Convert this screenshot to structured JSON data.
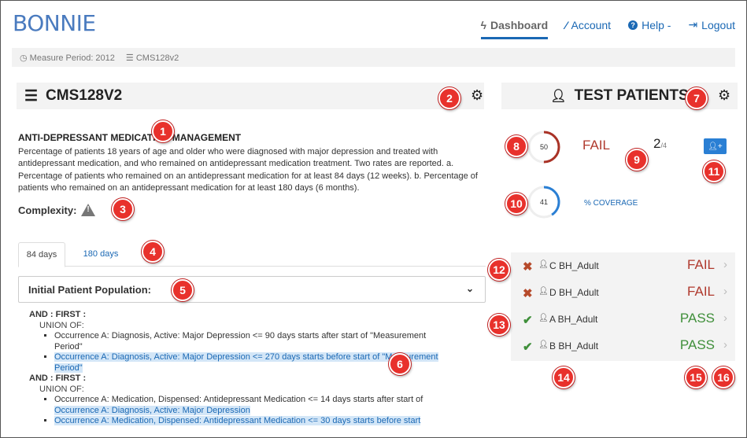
{
  "brand": "BONNIE",
  "nav": [
    {
      "icon": "lightning-icon",
      "glyph": "ϟ",
      "label": "Dashboard",
      "active": true
    },
    {
      "icon": "magic-wand-icon",
      "glyph": "⁄",
      "label": "Account"
    },
    {
      "icon": "question-circle-icon",
      "glyph": "?",
      "label": "Help -"
    },
    {
      "icon": "logout-icon",
      "glyph": "⇥",
      "label": "Logout"
    }
  ],
  "breadcrumb": {
    "period": "Measure Period: 2012",
    "measure": "CMS128v2"
  },
  "measure": {
    "header": "CMS128V2",
    "title": "ANTI-DEPRESSANT MEDICATION MANAGEMENT",
    "description": "Percentage of patients 18 years of age and older who were diagnosed with major depression and treated with antidepressant medication, and who remained on antidepressant medication treatment. Two rates are reported. a. Percentage of patients who remained on an antidepressant medication for at least 84 days (12 weeks). b. Percentage of patients who remained on an antidepressant medication for at least 180 days (6 months).",
    "complexity_label": "Complexity:"
  },
  "tabs": [
    "84 days",
    "180 days"
  ],
  "population_dropdown": "Initial Patient Population:",
  "logic": {
    "and1": "AND : FIRST :",
    "union1": "UNION OF:",
    "item1": "Occurrence A: Diagnosis, Active: Major Depression <= 90 days starts after start of \"Measurement Period\"",
    "item2": "Occurrence A: Diagnosis, Active: Major Depression <= 270 days starts before start of \"Measurement Period\"",
    "and2": "AND : FIRST :",
    "union2": "UNION OF:",
    "item3": "Occurrence A: Medication, Dispensed: Antidepressant Medication <= 14 days starts after start of",
    "item3b": "Occurrence A: Diagnosis, Active: Major Depression",
    "item4": "Occurrence A: Medication, Dispensed: Antidepressant Medication <= 30 days starts before start"
  },
  "test_patients": {
    "header": "TEST PATIENTS",
    "fail_donut": 50,
    "fail_label": "FAIL",
    "count": "2",
    "count_total": "/4",
    "coverage_donut": 41,
    "coverage_label": "% COVERAGE",
    "add_label": "+",
    "patients": [
      {
        "result": "fail",
        "name": "C BH_Adult",
        "status": "FAIL"
      },
      {
        "result": "fail",
        "name": "D BH_Adult",
        "status": "FAIL"
      },
      {
        "result": "pass",
        "name": "A BH_Adult",
        "status": "PASS"
      },
      {
        "result": "pass",
        "name": "B BH_Adult",
        "status": "PASS"
      }
    ]
  },
  "callouts": [
    "1",
    "2",
    "3",
    "4",
    "5",
    "6",
    "7",
    "8",
    "9",
    "10",
    "11",
    "12",
    "13",
    "14",
    "15",
    "16"
  ],
  "colors": {
    "accent": "#1a68b4",
    "fail": "#b03a2e",
    "pass": "#3f8f3a",
    "callout": "#e8312c"
  }
}
